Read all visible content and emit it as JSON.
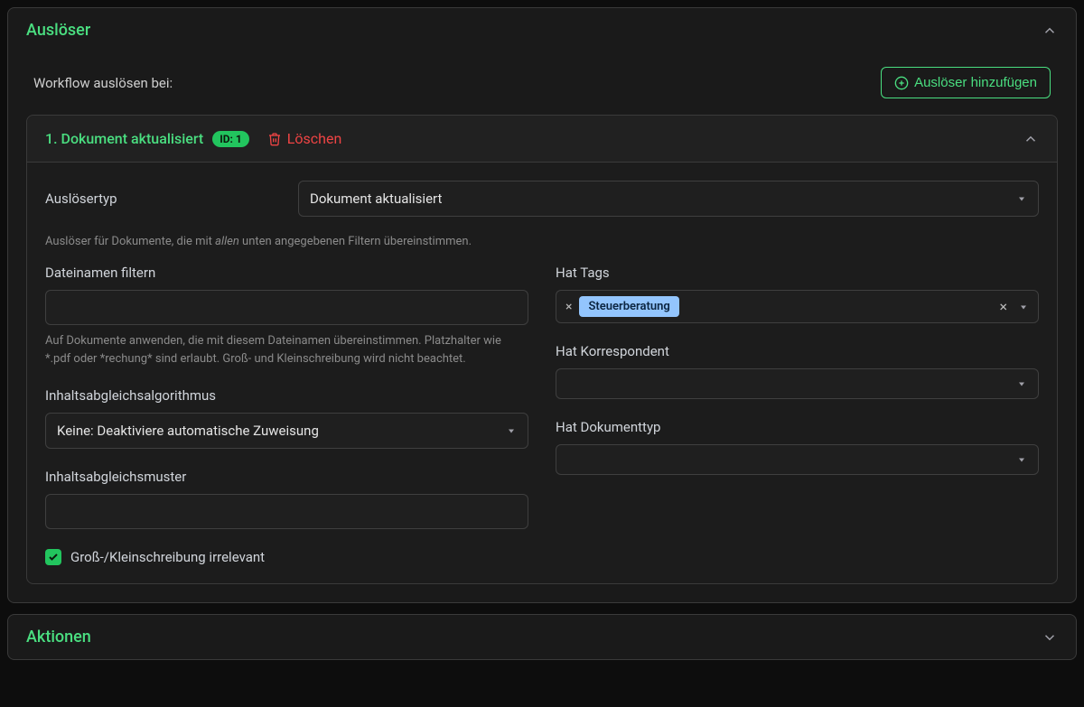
{
  "panels": {
    "triggers": {
      "title": "Auslöser"
    },
    "actions": {
      "title": "Aktionen"
    }
  },
  "triggers_section": {
    "subtitle": "Workflow auslösen bei:",
    "add_button": "Auslöser hinzufügen"
  },
  "trigger1": {
    "title": "1. Dokument aktualisiert",
    "badge": "ID: 1",
    "delete": "Löschen",
    "type_label": "Auslösertyp",
    "type_value": "Dokument aktualisiert",
    "filter_note_before": "Auslöser für Dokumente, die mit ",
    "filter_note_em": "allen",
    "filter_note_after": " unten angegebenen Filtern übereinstimmen.",
    "left": {
      "filename_label": "Dateinamen filtern",
      "filename_hint": "Auf Dokumente anwenden, die mit diesem Dateinamen übereinstimmen. Platzhalter wie *.pdf oder *rechung* sind erlaubt. Groß- und Kleinschreibung wird nicht beachtet.",
      "algo_label": "Inhaltsabgleichsalgorithmus",
      "algo_value": "Keine: Deaktiviere automatische Zuweisung",
      "pattern_label": "Inhaltsabgleichsmuster",
      "case_label": "Groß-/Kleinschreibung irrelevant"
    },
    "right": {
      "tags_label": "Hat Tags",
      "tag_value": "Steuerberatung",
      "correspondent_label": "Hat Korrespondent",
      "doctype_label": "Hat Dokumenttyp"
    }
  }
}
